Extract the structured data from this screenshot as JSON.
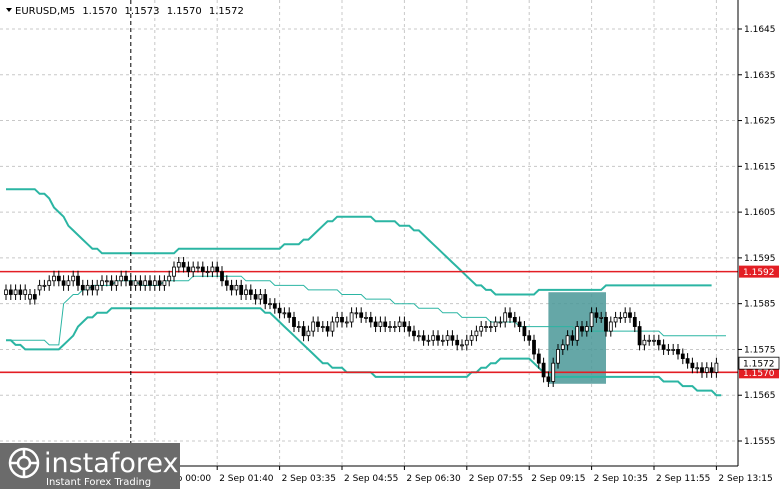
{
  "chart_data": {
    "type": "candlestick",
    "symbol_line": {
      "symbol": "EURUSD,M5",
      "open": "1.1570",
      "high": "1.1573",
      "low": "1.1570",
      "close": "1.1572"
    },
    "ylim": [
      1.155,
      1.165
    ],
    "y_ticks": [
      "1.1645",
      "1.1635",
      "1.1625",
      "1.1615",
      "1.1605",
      "1.1595",
      "1.1585",
      "1.1575",
      "1.1565",
      "1.1555"
    ],
    "x_ticks": [
      "2 Sep 00:00",
      "2 Sep 01:40",
      "2 Sep 03:35",
      "2 Sep 04:55",
      "2 Sep 06:30",
      "2 Sep 07:55",
      "2 Sep 09:15",
      "2 Sep 10:35",
      "2 Sep 11:55",
      "2 Sep 13:15"
    ],
    "x_tick_at_index": [
      31,
      44,
      57,
      70,
      83,
      96,
      109,
      122,
      135,
      148
    ],
    "current_price_label": "1.1572",
    "levels": [
      {
        "value": 1.1592,
        "label": "1.1592",
        "color": "#e31e24"
      },
      {
        "value": 1.157,
        "label": "1.1570",
        "color": "#e31e24"
      }
    ],
    "highlight_zone": {
      "from_index": 113,
      "to_index": 125,
      "from_price": 1.15675,
      "to_price": 1.15875,
      "color": "#4a9898"
    },
    "crosshair_index": 26,
    "band_color": "#2bb5a3",
    "bollinger_upper": [
      1.161,
      1.161,
      1.161,
      1.161,
      1.161,
      1.161,
      1.161,
      1.1609,
      1.1609,
      1.1608,
      1.1606,
      1.1605,
      1.1604,
      1.1602,
      1.1601,
      1.16,
      1.1599,
      1.1598,
      1.1597,
      1.1597,
      1.1596,
      1.1596,
      1.1596,
      1.1596,
      1.1596,
      1.1596,
      1.1596,
      1.1596,
      1.1596,
      1.1596,
      1.1596,
      1.1596,
      1.1596,
      1.1596,
      1.1596,
      1.1596,
      1.1597,
      1.1597,
      1.1597,
      1.1597,
      1.1597,
      1.1597,
      1.1597,
      1.1597,
      1.1597,
      1.1597,
      1.1597,
      1.1597,
      1.1597,
      1.1597,
      1.1597,
      1.1597,
      1.1597,
      1.1597,
      1.1597,
      1.1597,
      1.1597,
      1.1597,
      1.1598,
      1.1598,
      1.1598,
      1.1598,
      1.1599,
      1.1599,
      1.16,
      1.1601,
      1.1602,
      1.1603,
      1.1603,
      1.1604,
      1.1604,
      1.1604,
      1.1604,
      1.1604,
      1.1604,
      1.1604,
      1.1604,
      1.1603,
      1.1603,
      1.1603,
      1.1603,
      1.1603,
      1.1602,
      1.1602,
      1.1602,
      1.1601,
      1.1601,
      1.16,
      1.1599,
      1.1598,
      1.1597,
      1.1596,
      1.1595,
      1.1594,
      1.1593,
      1.1592,
      1.1591,
      1.159,
      1.1589,
      1.1589,
      1.1588,
      1.1588,
      1.1587,
      1.1587,
      1.1587,
      1.1587,
      1.1587,
      1.1587,
      1.1587,
      1.1587,
      1.1587,
      1.1588,
      1.1588,
      1.1588,
      1.1588,
      1.1588,
      1.1588,
      1.1588,
      1.1588,
      1.1588,
      1.1588,
      1.1588,
      1.1588,
      1.1588,
      1.1588,
      1.1589,
      1.1589,
      1.1589,
      1.1589,
      1.1589,
      1.1589,
      1.1589,
      1.1589,
      1.1589,
      1.1589,
      1.1589,
      1.1589,
      1.1589,
      1.1589,
      1.1589,
      1.1589,
      1.1589,
      1.1589,
      1.1589,
      1.1589,
      1.1589,
      1.1589,
      1.1589
    ],
    "bollinger_middle": [
      1.1577,
      1.1577,
      1.1577,
      1.1577,
      1.1577,
      1.1577,
      1.1577,
      1.1577,
      1.1577,
      1.1576,
      1.1576,
      1.1576,
      1.1585,
      1.1586,
      1.1587,
      1.1587,
      1.1588,
      1.1588,
      1.1589,
      1.1589,
      1.1589,
      1.1589,
      1.1589,
      1.159,
      1.159,
      1.159,
      1.159,
      1.159,
      1.1589,
      1.1589,
      1.1589,
      1.1589,
      1.1589,
      1.159,
      1.159,
      1.159,
      1.159,
      1.159,
      1.159,
      1.1591,
      1.1591,
      1.1591,
      1.1591,
      1.1591,
      1.1591,
      1.1591,
      1.1591,
      1.1591,
      1.1591,
      1.1591,
      1.159,
      1.159,
      1.159,
      1.159,
      1.159,
      1.159,
      1.1589,
      1.1589,
      1.1589,
      1.1589,
      1.1589,
      1.1589,
      1.1589,
      1.1588,
      1.1588,
      1.1588,
      1.1588,
      1.1588,
      1.1588,
      1.1588,
      1.1587,
      1.1587,
      1.1587,
      1.1587,
      1.1587,
      1.1586,
      1.1586,
      1.1586,
      1.1586,
      1.1586,
      1.1586,
      1.1585,
      1.1585,
      1.1585,
      1.1585,
      1.1585,
      1.1584,
      1.1584,
      1.1584,
      1.1584,
      1.1584,
      1.1583,
      1.1583,
      1.1583,
      1.1583,
      1.1582,
      1.1582,
      1.1582,
      1.1582,
      1.1582,
      1.1582,
      1.1581,
      1.1581,
      1.1581,
      1.1581,
      1.1581,
      1.1581,
      1.158,
      1.158,
      1.158,
      1.158,
      1.158,
      1.158,
      1.158,
      1.158,
      1.158,
      1.158,
      1.158,
      1.158,
      1.1579,
      1.1579,
      1.1579,
      1.1579,
      1.1579,
      1.1579,
      1.1579,
      1.1579,
      1.1579,
      1.1579,
      1.1579,
      1.1579,
      1.1579,
      1.1579,
      1.1579,
      1.1579,
      1.1579,
      1.1579,
      1.1578,
      1.1578,
      1.1578,
      1.1578,
      1.1578,
      1.1578,
      1.1578,
      1.1578,
      1.1578,
      1.1578,
      1.1578,
      1.1578,
      1.1578,
      1.1578
    ],
    "bollinger_lower": [
      1.1577,
      1.1577,
      1.1576,
      1.1576,
      1.1575,
      1.1575,
      1.1575,
      1.1575,
      1.1575,
      1.1575,
      1.1575,
      1.1575,
      1.1576,
      1.1577,
      1.1578,
      1.158,
      1.1581,
      1.1582,
      1.1582,
      1.1583,
      1.1583,
      1.1583,
      1.1584,
      1.1584,
      1.1584,
      1.1584,
      1.1584,
      1.1584,
      1.1584,
      1.1584,
      1.1584,
      1.1584,
      1.1584,
      1.1584,
      1.1584,
      1.1584,
      1.1584,
      1.1584,
      1.1584,
      1.1584,
      1.1584,
      1.1584,
      1.1584,
      1.1584,
      1.1584,
      1.1584,
      1.1584,
      1.1584,
      1.1584,
      1.1584,
      1.1584,
      1.1584,
      1.1584,
      1.1584,
      1.1583,
      1.1583,
      1.1582,
      1.1581,
      1.158,
      1.1579,
      1.1578,
      1.1577,
      1.1576,
      1.1575,
      1.1574,
      1.1573,
      1.1572,
      1.1572,
      1.1571,
      1.1571,
      1.1571,
      1.157,
      1.157,
      1.157,
      1.157,
      1.157,
      1.157,
      1.1569,
      1.1569,
      1.1569,
      1.1569,
      1.1569,
      1.1569,
      1.1569,
      1.1569,
      1.1569,
      1.1569,
      1.1569,
      1.1569,
      1.1569,
      1.1569,
      1.1569,
      1.1569,
      1.1569,
      1.1569,
      1.1569,
      1.1569,
      1.157,
      1.157,
      1.1571,
      1.1571,
      1.1572,
      1.1572,
      1.1573,
      1.1573,
      1.1573,
      1.1573,
      1.1573,
      1.1573,
      1.1573,
      1.1572,
      1.1571,
      1.157,
      1.157,
      1.1569,
      1.1569,
      1.1569,
      1.1569,
      1.1569,
      1.1569,
      1.1569,
      1.1569,
      1.1569,
      1.1569,
      1.1569,
      1.1569,
      1.1569,
      1.1569,
      1.1569,
      1.1569,
      1.1569,
      1.1569,
      1.1569,
      1.1569,
      1.1569,
      1.1569,
      1.1569,
      1.1568,
      1.1568,
      1.1568,
      1.1568,
      1.1567,
      1.1567,
      1.1567,
      1.1566,
      1.1566,
      1.1566,
      1.1566,
      1.1565,
      1.1565
    ],
    "close": [
      1.1588,
      1.1587,
      1.1588,
      1.1587,
      1.1588,
      1.1587,
      1.1586,
      1.1589,
      1.1589,
      1.159,
      1.1591,
      1.159,
      1.1589,
      1.159,
      1.1591,
      1.1589,
      1.1588,
      1.1589,
      1.1588,
      1.1589,
      1.159,
      1.159,
      1.1589,
      1.159,
      1.1591,
      1.159,
      1.1589,
      1.159,
      1.1589,
      1.159,
      1.1589,
      1.159,
      1.1589,
      1.159,
      1.1591,
      1.1593,
      1.1594,
      1.1593,
      1.1592,
      1.1593,
      1.1593,
      1.1592,
      1.1592,
      1.1593,
      1.1592,
      1.159,
      1.1589,
      1.1588,
      1.1589,
      1.1587,
      1.1588,
      1.1587,
      1.1586,
      1.1587,
      1.1585,
      1.1585,
      1.1584,
      1.1583,
      1.1583,
      1.1582,
      1.158,
      1.158,
      1.1578,
      1.1579,
      1.1581,
      1.158,
      1.158,
      1.1579,
      1.1581,
      1.1582,
      1.1581,
      1.1581,
      1.1583,
      1.1583,
      1.1582,
      1.1582,
      1.1581,
      1.158,
      1.1581,
      1.158,
      1.158,
      1.158,
      1.1581,
      1.158,
      1.1579,
      1.1578,
      1.1578,
      1.1577,
      1.1577,
      1.1578,
      1.1577,
      1.1577,
      1.1578,
      1.1577,
      1.1576,
      1.1576,
      1.1577,
      1.1578,
      1.1579,
      1.158,
      1.158,
      1.158,
      1.1581,
      1.1581,
      1.1583,
      1.1582,
      1.1581,
      1.158,
      1.1578,
      1.1577,
      1.1574,
      1.1572,
      1.1569,
      1.1568,
      1.1572,
      1.1575,
      1.1576,
      1.1578,
      1.1577,
      1.158,
      1.1579,
      1.158,
      1.1583,
      1.1582,
      1.1582,
      1.1579,
      1.1581,
      1.1582,
      1.1582,
      1.1583,
      1.1582,
      1.158,
      1.1576,
      1.1577,
      1.1577,
      1.1577,
      1.1576,
      1.1575,
      1.1575,
      1.1575,
      1.1574,
      1.1573,
      1.1572,
      1.1571,
      1.1571,
      1.157,
      1.1571,
      1.157,
      1.1572
    ],
    "open": [
      1.1587,
      1.1588,
      1.1587,
      1.1588,
      1.1587,
      1.1586,
      1.1587,
      1.1588,
      1.1589,
      1.1589,
      1.159,
      1.1591,
      1.159,
      1.1589,
      1.159,
      1.1591,
      1.1589,
      1.1588,
      1.1589,
      1.1588,
      1.1589,
      1.159,
      1.159,
      1.1589,
      1.159,
      1.1591,
      1.159,
      1.1589,
      1.159,
      1.1589,
      1.159,
      1.1589,
      1.159,
      1.1589,
      1.159,
      1.1591,
      1.1593,
      1.1594,
      1.1593,
      1.1592,
      1.1593,
      1.1593,
      1.1592,
      1.1592,
      1.1593,
      1.1592,
      1.159,
      1.1589,
      1.1588,
      1.1589,
      1.1587,
      1.1588,
      1.1587,
      1.1586,
      1.1587,
      1.1585,
      1.1585,
      1.1584,
      1.1583,
      1.1583,
      1.1582,
      1.158,
      1.158,
      1.1578,
      1.1579,
      1.1581,
      1.158,
      1.158,
      1.1579,
      1.1581,
      1.1582,
      1.1581,
      1.1581,
      1.1583,
      1.1583,
      1.1582,
      1.1582,
      1.1581,
      1.158,
      1.1581,
      1.158,
      1.158,
      1.158,
      1.1581,
      1.158,
      1.1579,
      1.1578,
      1.1578,
      1.1577,
      1.1577,
      1.1578,
      1.1577,
      1.1577,
      1.1578,
      1.1577,
      1.1576,
      1.1576,
      1.1577,
      1.1578,
      1.1579,
      1.158,
      1.158,
      1.158,
      1.1581,
      1.1581,
      1.1583,
      1.1582,
      1.1581,
      1.158,
      1.1578,
      1.1577,
      1.1574,
      1.1572,
      1.1569,
      1.1568,
      1.1572,
      1.1575,
      1.1576,
      1.1578,
      1.1577,
      1.158,
      1.1579,
      1.158,
      1.1583,
      1.1582,
      1.1582,
      1.1579,
      1.1581,
      1.1582,
      1.1582,
      1.1583,
      1.1582,
      1.158,
      1.1576,
      1.1577,
      1.1577,
      1.1577,
      1.1576,
      1.1575,
      1.1575,
      1.1575,
      1.1574,
      1.1573,
      1.1572,
      1.1571,
      1.1571,
      1.157,
      1.1571,
      1.157
    ]
  },
  "watermark": {
    "brand": "instaforex",
    "tagline": "Instant Forex Trading"
  },
  "colors": {
    "grid": "#c8c8c8",
    "axis": "#000000",
    "candle": "#000000",
    "level": "#e31e24",
    "band": "#2bb5a3",
    "zone": "#4a9898",
    "crosshair": "#000000",
    "watermark_bg": "#6b6b6b"
  }
}
